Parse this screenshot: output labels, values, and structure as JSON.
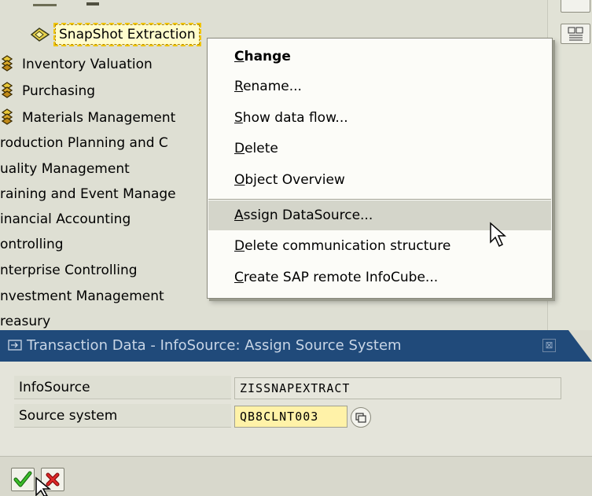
{
  "tree": {
    "selected_node": "SnapShot Extraction",
    "nodes": [
      {
        "label": "Inventory Valuation",
        "icon": "infoarea-folder-icon"
      },
      {
        "label": "Purchasing",
        "icon": "infoarea-folder-icon"
      },
      {
        "label": "Materials Management",
        "icon": "infoarea-folder-icon"
      },
      {
        "label": "roduction Planning and C",
        "icon": ""
      },
      {
        "label": "uality Management",
        "icon": ""
      },
      {
        "label": "raining and Event Manage",
        "icon": ""
      },
      {
        "label": "inancial Accounting",
        "icon": ""
      },
      {
        "label": "ontrolling",
        "icon": ""
      },
      {
        "label": "nterprise Controlling",
        "icon": ""
      },
      {
        "label": "nvestment Management",
        "icon": ""
      },
      {
        "label": "reasury",
        "icon": ""
      }
    ]
  },
  "context_menu": {
    "items": [
      {
        "label": "Change",
        "ul": "C",
        "rest": "hange"
      },
      {
        "label": "Rename...",
        "ul": "R",
        "rest": "ename..."
      },
      {
        "label": "Show data flow...",
        "ul": "S",
        "rest": "how data flow..."
      },
      {
        "label": "Delete",
        "ul": "D",
        "rest": "elete"
      },
      {
        "label": "Object Overview",
        "ul": "O",
        "rest": "bject Overview"
      },
      {
        "label": "Assign DataSource...",
        "ul": "A",
        "rest": "ssign DataSource..."
      },
      {
        "label": "Delete communication structure",
        "ul": "D",
        "rest": "elete communication structure"
      },
      {
        "label": "Create SAP remote InfoCube...",
        "ul": "C",
        "rest": "reate SAP remote InfoCube..."
      }
    ]
  },
  "dialog": {
    "title": "Transaction Data - InfoSource: Assign Source System",
    "close_glyph": "⊠",
    "fields": {
      "infosource_label": "InfoSource",
      "infosource_value": "ZISSNAPEXTRACT",
      "source_system_label": "Source system",
      "source_system_value": "QB8CLNT003"
    }
  },
  "colors": {
    "title_bar": "#204a7a",
    "selection_fill": "#fffccd",
    "edit_field": "#fff2a8",
    "confirm_check": "#2a9a1e",
    "cancel_x": "#d42020"
  }
}
